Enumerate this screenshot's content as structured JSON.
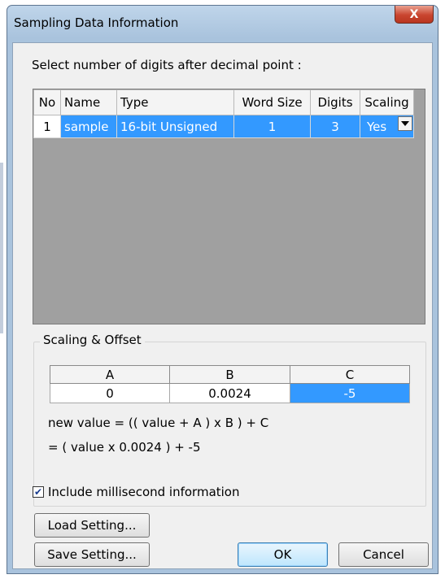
{
  "window": {
    "title": "Sampling Data Information",
    "close_glyph": "X"
  },
  "prompt": "Select number of digits after decimal point :",
  "grid": {
    "headers": [
      "No",
      "Name",
      "Type",
      "Word Size",
      "Digits",
      "Scaling"
    ],
    "rows": [
      {
        "no": "1",
        "name": "sample",
        "type": "16-bit Unsigned",
        "word_size": "1",
        "digits": "3",
        "scaling": "Yes"
      }
    ]
  },
  "scaling_offset": {
    "title": "Scaling & Offset",
    "headers": [
      "A",
      "B",
      "C"
    ],
    "values": [
      "0",
      "0.0024",
      "-5"
    ],
    "formula_line1": "new value = (( value + A ) x B ) + C",
    "formula_line2": "= ( value x 0.0024 ) + -5"
  },
  "checkbox": {
    "label": "Include millisecond information",
    "checked": true
  },
  "buttons": {
    "load": "Load Setting...",
    "save": "Save Setting...",
    "ok": "OK",
    "cancel": "Cancel"
  },
  "colors": {
    "selection": "#3399ff",
    "grid_background": "#a0a0a0",
    "dialog_face": "#f0f0f0"
  }
}
